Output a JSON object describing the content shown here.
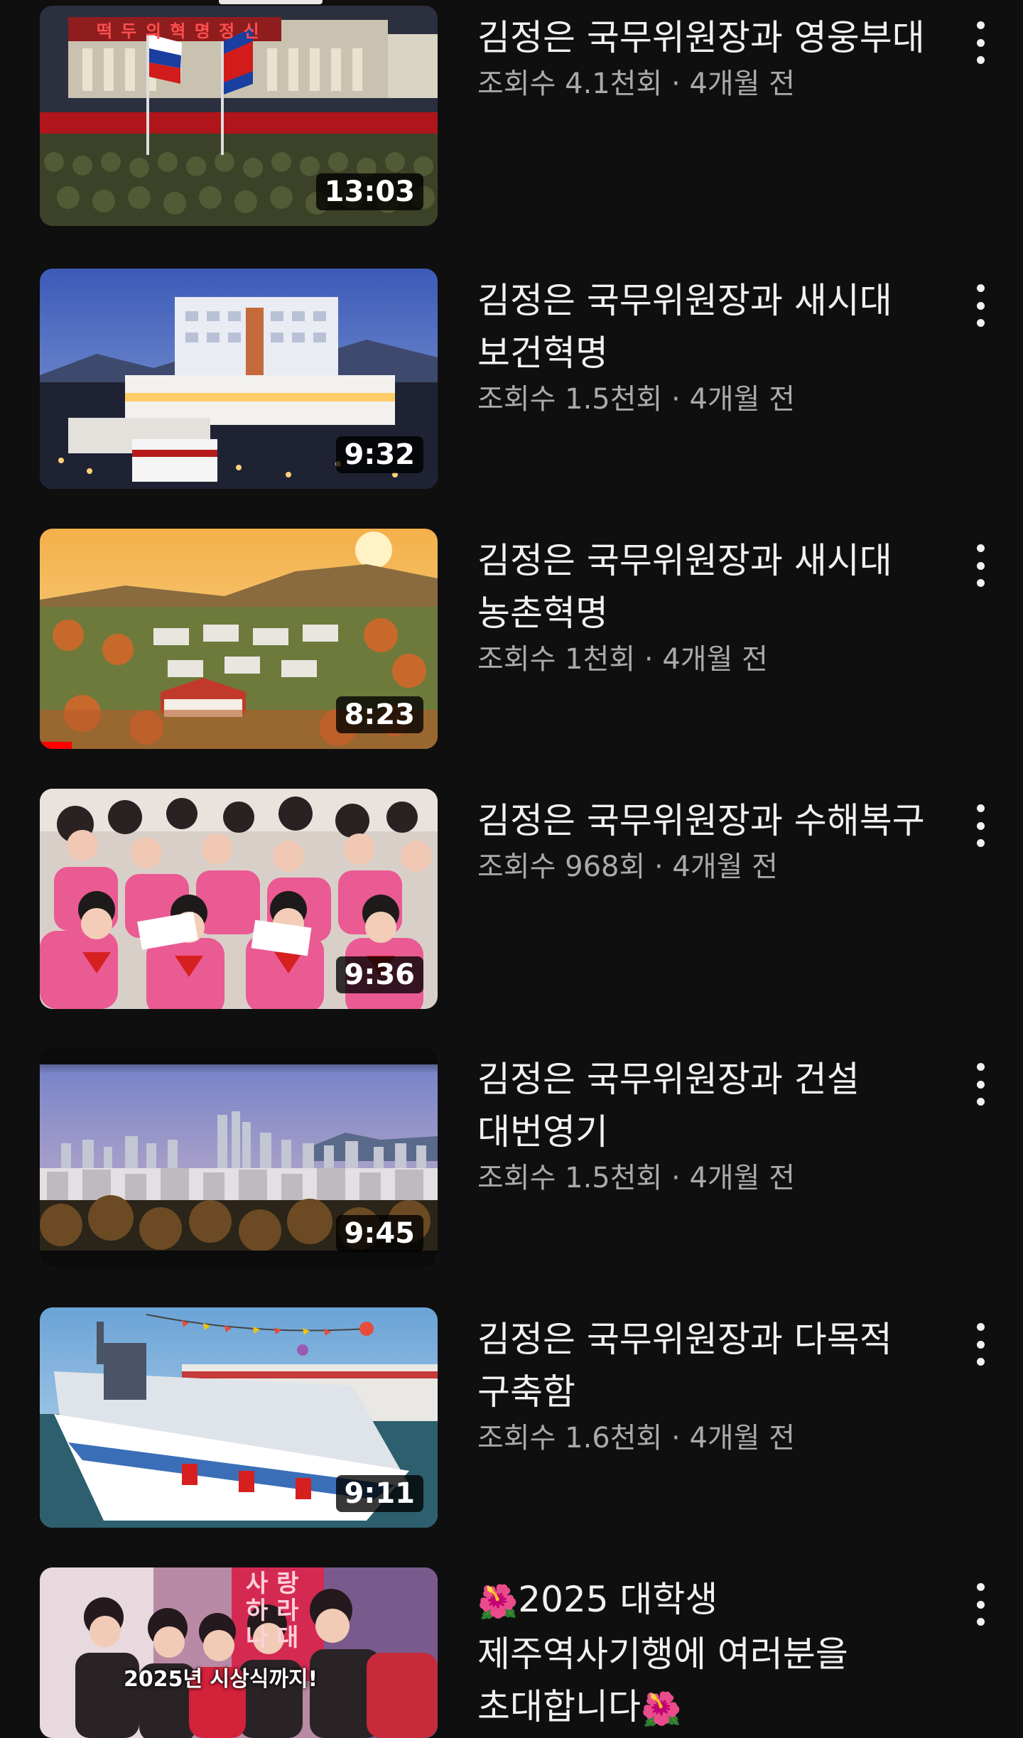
{
  "videos": [
    {
      "title": "김정은 국무위원장과 영웅부대",
      "views": "조회수 4.1천회",
      "age": "4개월 전",
      "duration": "13:03",
      "thumb_banner": "떡 두 의 혁 명 정 신"
    },
    {
      "title": "김정은 국무위원장과 새시대 보건혁명",
      "views": "조회수 1.5천회",
      "age": "4개월 전",
      "duration": "9:32"
    },
    {
      "title": "김정은 국무위원장과 새시대 농촌혁명",
      "views": "조회수 1천회",
      "age": "4개월 전",
      "duration": "8:23",
      "watch_progress": 0.08
    },
    {
      "title": "김정은 국무위원장과 수해복구",
      "views": "조회수 968회",
      "age": "4개월 전",
      "duration": "9:36"
    },
    {
      "title": "김정은 국무위원장과 건설 대번영기",
      "views": "조회수 1.5천회",
      "age": "4개월 전",
      "duration": "9:45"
    },
    {
      "title": "김정은 국무위원장과 다목적 구축함",
      "views": "조회수 1.6천회",
      "age": "4개월 전",
      "duration": "9:11"
    },
    {
      "title_line1": "2025 대학생",
      "title_line2": "제주역사기행에 여러분을",
      "title_line3": "초대합니다",
      "thumb_caption": "2025년 시상식까지!",
      "thumb_sign": "사 랑 하 라 나 대"
    }
  ],
  "icons": {
    "menu": "more-vert-icon",
    "flower": "hibiscus-icon"
  },
  "colors": {
    "background": "#0f0f0f",
    "title": "#f1f1f1",
    "meta": "#aaaaaa",
    "progress": "#ff0000"
  }
}
